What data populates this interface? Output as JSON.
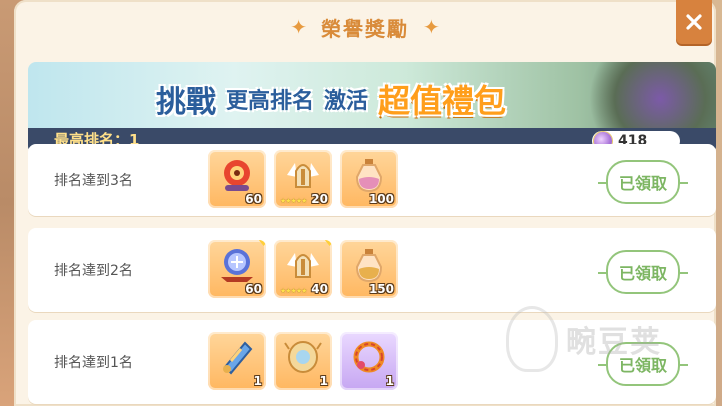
{
  "dialog": {
    "title": "榮譽獎勵",
    "title_star": "✦"
  },
  "banner": {
    "words": [
      "挑戰",
      "更高排名",
      "激活",
      "超值禮包"
    ],
    "best_rank_label": "最高排名：1",
    "currency_value": "418"
  },
  "rows": [
    {
      "label": "排名達到3名",
      "status": "已領取",
      "items": [
        {
          "icon": "crystal-orb-icon",
          "count": "60",
          "bg": "orange"
        },
        {
          "icon": "winged-helmet-icon",
          "count": "20",
          "bg": "orange",
          "stars": "★★★★★"
        },
        {
          "icon": "potion-bottle-icon",
          "count": "100",
          "bg": "orange"
        }
      ]
    },
    {
      "label": "排名達到2名",
      "status": "已領取",
      "items": [
        {
          "icon": "magic-orb-icon",
          "count": "60",
          "bg": "orange"
        },
        {
          "icon": "winged-helmet-icon",
          "count": "40",
          "bg": "orange",
          "stars": "★★★★★"
        },
        {
          "icon": "potion-bottle-icon",
          "count": "150",
          "bg": "orange"
        }
      ]
    },
    {
      "label": "排名達到1名",
      "status": "已領取",
      "items": [
        {
          "icon": "scroll-icon",
          "count": "1",
          "bg": "orange"
        },
        {
          "icon": "medallion-icon",
          "count": "1",
          "bg": "orange"
        },
        {
          "icon": "dragon-ring-icon",
          "count": "1",
          "bg": "purple"
        }
      ]
    }
  ],
  "watermark_text": "畹豆荚",
  "colors": {
    "title": "#d98b3a",
    "close_button": "#d7823e",
    "claimed": "#7db663",
    "banner_bar": "#3a4a68",
    "rank_text": "#ffe08a"
  }
}
